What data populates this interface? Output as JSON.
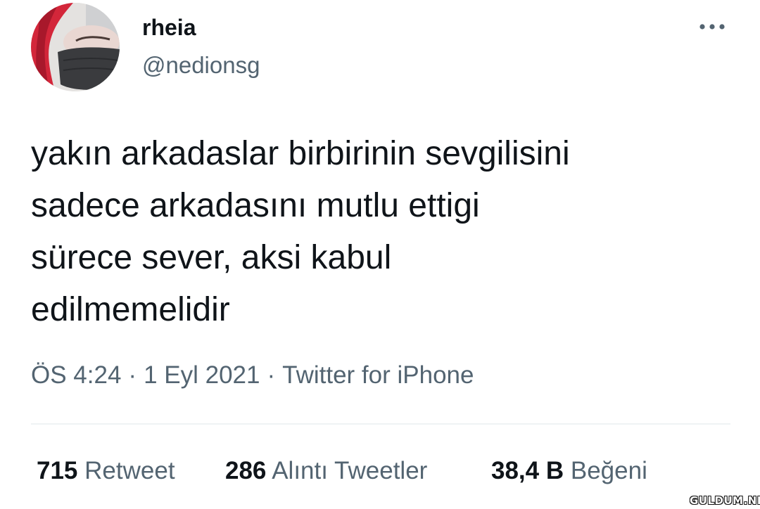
{
  "user": {
    "display_name": "rheia",
    "handle": "@nedionsg"
  },
  "tweet": {
    "text": "yakın arkadaslar birbirinin sevgilisini\nsadece arkadasını mutlu ettigi\nsürece sever, aksi kabul\nedilmemelidir"
  },
  "meta": {
    "time": "ÖS 4:24",
    "separator": "·",
    "date": "1 Eyl 2021",
    "source": "Twitter for iPhone"
  },
  "stats": {
    "retweets": {
      "count": "715",
      "label": "Retweet"
    },
    "quotes": {
      "count": "286",
      "label": "Alıntı Tweetler"
    },
    "likes": {
      "count": "38,4 B",
      "label": "Beğeni"
    }
  },
  "icons": {
    "more": "more-horizontal-icon"
  },
  "colors": {
    "text_primary": "#0f1419",
    "text_secondary": "#536471",
    "divider": "#eff3f4",
    "avatar_hair": "#d3263a"
  },
  "watermark": {
    "text": "GULDUM.NET"
  }
}
